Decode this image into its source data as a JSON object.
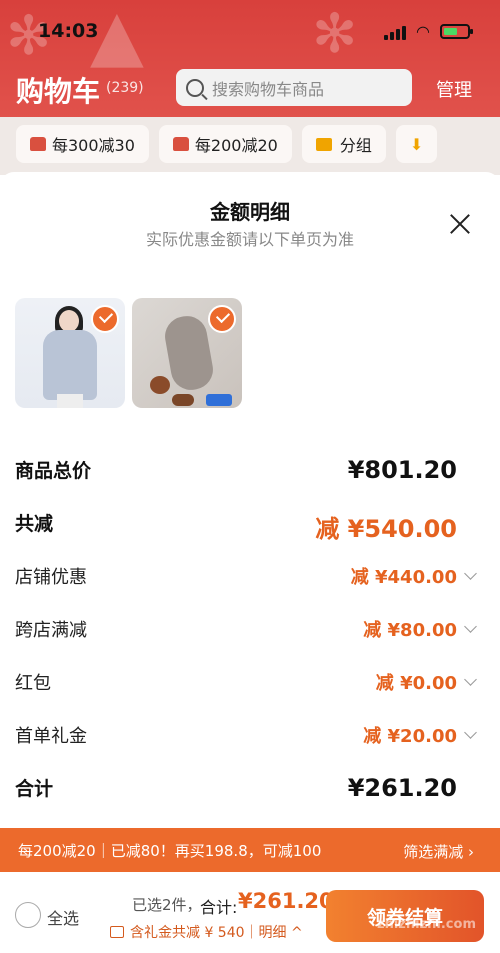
{
  "status": {
    "time": "14:03"
  },
  "header": {
    "title": "购物车",
    "count": "(239)",
    "search_placeholder": "搜索购物车商品",
    "manage": "管理"
  },
  "chips": [
    {
      "label": "每300减30"
    },
    {
      "label": "每200减20"
    },
    {
      "label": "分组"
    }
  ],
  "sheet": {
    "title": "金额明细",
    "subtitle": "实际优惠金额请以下单页为准",
    "rows": [
      {
        "label": "商品总价",
        "value": "¥801.20"
      },
      {
        "label": "共减",
        "value": "减 ¥540.00"
      },
      {
        "label": "店铺优惠",
        "value": "减 ¥440.00"
      },
      {
        "label": "跨店满减",
        "value": "减 ¥80.00"
      },
      {
        "label": "红包",
        "value": "减 ¥0.00"
      },
      {
        "label": "首单礼金",
        "value": "减 ¥20.00"
      },
      {
        "label": "合计",
        "value": "¥261.20"
      }
    ]
  },
  "promo": {
    "text": "每200减20｜已减80！再买198.8，可减100",
    "action": "筛选满减 ›"
  },
  "bottom": {
    "select_all": "全选",
    "selected": "已选2件，",
    "total_label": "合计:",
    "total_value": "¥261.20",
    "gift_text": "含礼金共减 ¥ 540｜明细 ^",
    "pay_button": "领券结算",
    "watermark": "zhizhizhi.com"
  },
  "colors": {
    "brand": "#e45a52",
    "accent": "#ec6a2c"
  }
}
